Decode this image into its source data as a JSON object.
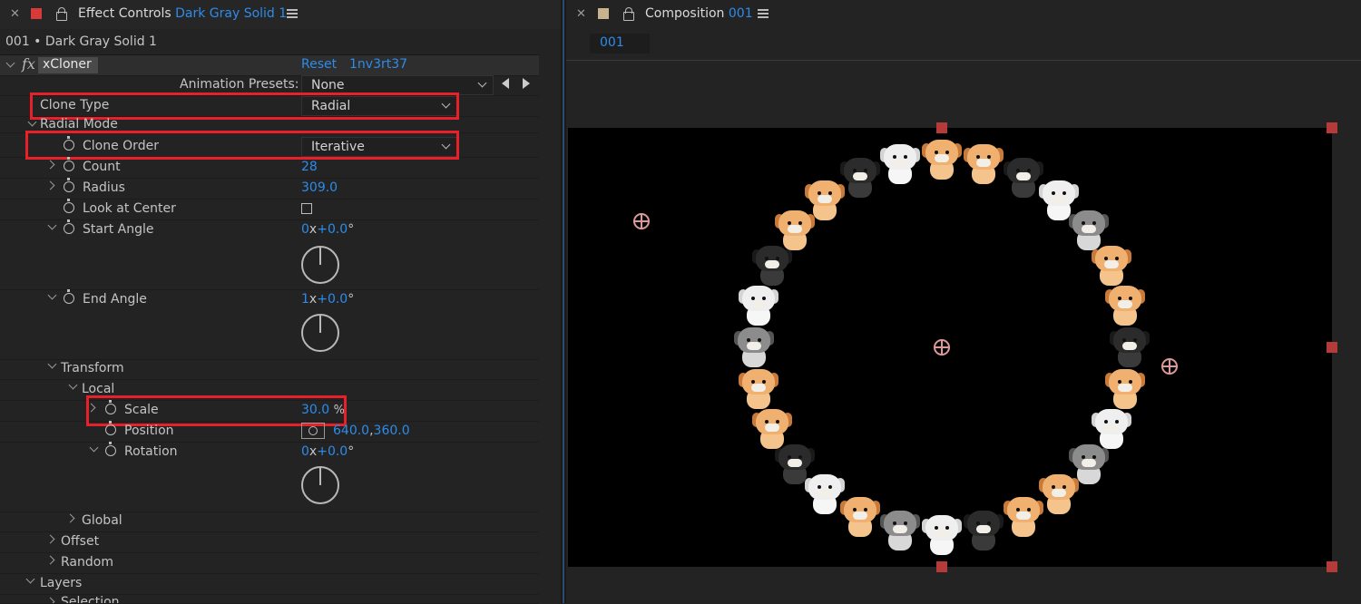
{
  "colors": {
    "accent_blue": "#2d8ceb",
    "highlight_red": "#e8202a",
    "panel_bg": "#232323",
    "canvas_bg": "#000000"
  },
  "left_panel": {
    "tab": {
      "prefix": "Effect Controls",
      "layer": "Dark Gray Solid 1"
    },
    "layer_title": "001 • Dark Gray Solid 1",
    "effect": {
      "badge": "fx",
      "name": "xCloner",
      "reset": "Reset",
      "version": "1nv3rt37"
    },
    "animation_presets": {
      "label": "Animation Presets:",
      "value": "None"
    },
    "clone_type": {
      "label": "Clone Type",
      "value": "Radial"
    },
    "radial_mode": {
      "label": "Radial Mode"
    },
    "clone_order": {
      "label": "Clone Order",
      "value": "Iterative"
    },
    "count": {
      "label": "Count",
      "value": "28"
    },
    "radius": {
      "label": "Radius",
      "value": "309.0"
    },
    "look_at_center": {
      "label": "Look at Center",
      "checked": false
    },
    "start_angle": {
      "label": "Start Angle",
      "rev": "0",
      "x": "x",
      "deg": "+0.0",
      "deg_sym": "°"
    },
    "end_angle": {
      "label": "End Angle",
      "rev": "1",
      "x": "x",
      "deg": "+0.0",
      "deg_sym": "°"
    },
    "transform": {
      "label": "Transform"
    },
    "local": {
      "label": "Local"
    },
    "scale": {
      "label": "Scale",
      "value": "30.0",
      "unit": "%"
    },
    "position": {
      "label": "Position",
      "x": "640.0",
      "sep": ",",
      "y": "360.0"
    },
    "rotation": {
      "label": "Rotation",
      "rev": "0",
      "x": "x",
      "deg": "+0.0",
      "deg_sym": "°"
    },
    "global": {
      "label": "Global"
    },
    "offset": {
      "label": "Offset"
    },
    "random": {
      "label": "Random"
    },
    "layers": {
      "label": "Layers"
    },
    "selection": {
      "label": "Selection"
    }
  },
  "right_panel": {
    "tab": {
      "prefix": "Composition",
      "name": "001"
    },
    "comp_tab_label": "001"
  }
}
